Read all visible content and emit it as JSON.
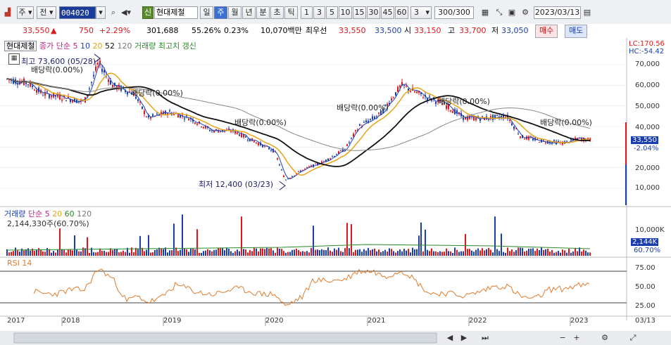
{
  "toolbar": {
    "type_select": "주",
    "market_label": "전",
    "code": "004020",
    "new_badge": "신",
    "stock_name": "현대제철",
    "period_tabs": [
      "일",
      "주",
      "월",
      "년",
      "분",
      "초",
      "틱"
    ],
    "active_period": "주",
    "interval_buttons": [
      "1",
      "3",
      "5",
      "10",
      "15",
      "30",
      "45",
      "60"
    ],
    "interval_select": "3",
    "count": "300/300",
    "date": "2023/03/13"
  },
  "quote": {
    "price": "33,550",
    "change_arrow": "▲",
    "change": "750",
    "change_pct": "+2.29%",
    "volume": "301,688",
    "vol_ratio": "55.26%",
    "turnover": "0.23%",
    "amount": "10,070백만",
    "best_label": "최우선",
    "ask": "33,550",
    "bid": "33,500",
    "open_label": "시",
    "open": "33,150",
    "high_label": "고",
    "high": "33,700",
    "low_label": "저",
    "low": "33,050",
    "buy_label": "매수",
    "sell_label": "매도"
  },
  "price_panel": {
    "stock_tag": "현대제철",
    "ma_label": "종가 단순",
    "ma_periods": [
      "5",
      "10",
      "20",
      "52",
      "120"
    ],
    "volume_note": "거래량 최고치 갱신",
    "lc": "LC:170.56",
    "hc": "HC:-54.42",
    "y_ticks": [
      "70,000",
      "60,000",
      "50,000",
      "40,000",
      "30,000",
      "20,000",
      "10,000"
    ],
    "current_price_tag": "33,550",
    "current_pct_tag": "-2.04%",
    "high_marker": "최고 73,600 (05/28)",
    "low_marker": "최저 12,400 (03/23)",
    "dividend_label": "배당락(0.00%)"
  },
  "volume_panel": {
    "label": "거래량",
    "ma_label": "단순",
    "ma_periods": [
      "5",
      "20",
      "60",
      "120"
    ],
    "value": "2,144,330주(60.70%)",
    "y_tick": "10,000K",
    "tag_value": "2,144K",
    "tag_pct": "60.70%"
  },
  "rsi_panel": {
    "label": "RSI 14",
    "y_ticks": [
      "75.00",
      "50.00",
      "25.00"
    ]
  },
  "x_axis": {
    "years": [
      "2017",
      "2018",
      "2019",
      "2020",
      "2021",
      "2022",
      "2023"
    ],
    "last": "03/13"
  },
  "colors": {
    "up": "#e0181b",
    "down": "#1b3eaf",
    "ma5": "#1f3fb8",
    "ma20": "#e8a317",
    "ma52": "#111111",
    "ma120": "#888888",
    "rsi": "#e07b2c"
  }
}
